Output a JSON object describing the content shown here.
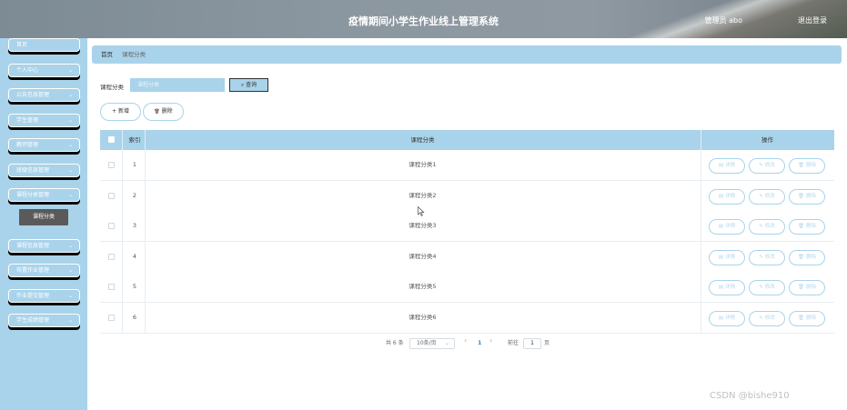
{
  "header": {
    "title": "疫情期间小学生作业线上管理系统",
    "user": "管理员 abo",
    "logout": "退出登录"
  },
  "sidebar": {
    "items": [
      {
        "label": "首页",
        "chevron": ""
      },
      {
        "label": "个人中心",
        "chevron": "⌄"
      },
      {
        "label": "公告信息管理",
        "chevron": "⌄"
      },
      {
        "label": "学生管理",
        "chevron": "⌄"
      },
      {
        "label": "教师管理",
        "chevron": "⌄"
      },
      {
        "label": "班级信息管理",
        "chevron": "⌄"
      },
      {
        "label": "课程分类管理",
        "chevron": "⌄"
      },
      {
        "label": "课程信息管理",
        "chevron": "⌄"
      },
      {
        "label": "布置作业管理",
        "chevron": "⌄"
      },
      {
        "label": "作业提交管理",
        "chevron": "⌄"
      },
      {
        "label": "学生成绩管理",
        "chevron": "⌄"
      }
    ],
    "sub_item": "课程分类"
  },
  "breadcrumb": {
    "home": "首页",
    "current": "课程分类"
  },
  "search": {
    "label": "课程分类",
    "placeholder": "课程分类",
    "button": "查询",
    "button_icon": "⌕"
  },
  "actions": {
    "add": "新增",
    "add_icon": "+",
    "delete": "删除",
    "delete_icon": "🗑"
  },
  "table": {
    "headers": {
      "index": "索引",
      "category": "课程分类",
      "ops": "操作"
    },
    "rows": [
      {
        "index": "1",
        "category": "课程分类1"
      },
      {
        "index": "2",
        "category": "课程分类2"
      },
      {
        "index": "3",
        "category": "课程分类3"
      },
      {
        "index": "4",
        "category": "课程分类4"
      },
      {
        "index": "5",
        "category": "课程分类5"
      },
      {
        "index": "6",
        "category": "课程分类6"
      }
    ],
    "row_buttons": {
      "detail": "详情",
      "edit": "修改",
      "delete": "删除"
    },
    "row_icons": {
      "detail": "▤",
      "edit": "✎",
      "delete": "🗑"
    }
  },
  "pagination": {
    "total": "共 6 条",
    "page_size": "10条/页",
    "prev": "‹",
    "current": "1",
    "next": "›",
    "goto": "前往",
    "goto_value": "1",
    "page_unit": "页"
  },
  "watermark": "CSDN @bishe910",
  "colors": {
    "accent": "#a9d3ea",
    "header": "#8b97a0",
    "active_sub": "#5a5a5a"
  }
}
